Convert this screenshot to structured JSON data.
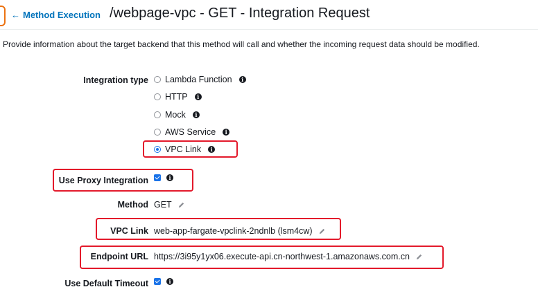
{
  "header": {
    "back_label": "Method Execution",
    "title": "/webpage-vpc - GET - Integration Request"
  },
  "description": "Provide information about the target backend that this method will call and whether the incoming request data should be modified.",
  "integration_type": {
    "label": "Integration type",
    "options": [
      {
        "label": "Lambda Function",
        "selected": false
      },
      {
        "label": "HTTP",
        "selected": false
      },
      {
        "label": "Mock",
        "selected": false
      },
      {
        "label": "AWS Service",
        "selected": false
      },
      {
        "label": "VPC Link",
        "selected": true
      }
    ]
  },
  "proxy": {
    "label": "Use Proxy Integration",
    "checked": true
  },
  "method": {
    "label": "Method",
    "value": "GET"
  },
  "vpc_link": {
    "label": "VPC Link",
    "value": "web-app-fargate-vpclink-2ndnlb (lsm4cw)"
  },
  "endpoint": {
    "label": "Endpoint URL",
    "value": "https://3i95y1yx06.execute-api.cn-northwest-1.amazonaws.com.cn"
  },
  "timeout": {
    "label": "Use Default Timeout",
    "checked": true
  },
  "colors": {
    "link": "#0073bb",
    "accent": "#ec7211",
    "highlight": "#e3192b",
    "control": "#1a73e8"
  },
  "icons": {
    "back": "arrow-left-icon",
    "info": "info-icon",
    "edit": "pencil-icon"
  }
}
